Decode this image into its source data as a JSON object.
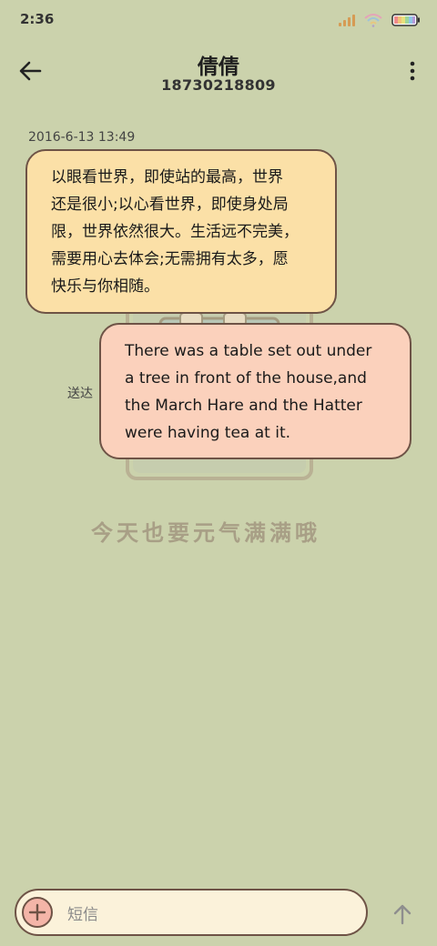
{
  "status_bar": {
    "time": "2:36"
  },
  "header": {
    "contact_name": "倩倩",
    "phone_number": "18730218809"
  },
  "conversation": {
    "timestamp": "2016-6-13 13:49",
    "incoming": [
      "以眼看世界，即使站的最高，世界",
      "还是很小;以心看世界，即使身处局",
      "限，世界依然很大。生活远不完美，",
      "需要用心去体会;无需拥有太多，愿",
      "快乐与你相随。"
    ],
    "outgoing": [
      "There was a table set out under",
      "a tree in front of the house,and",
      "the March Hare and the Hatter",
      "were having tea at it."
    ],
    "delivery_status": "送达"
  },
  "background": {
    "slogan": "今天也要元气满满哦"
  },
  "composer": {
    "placeholder": "短信"
  },
  "colors": {
    "background": "#cbd2ac",
    "incoming_bubble": "#fbe0a7",
    "outgoing_bubble": "#fbd1bc",
    "outline": "#6e5346",
    "input_bg": "#fbf2da",
    "add_button": "#f4b5a8"
  }
}
